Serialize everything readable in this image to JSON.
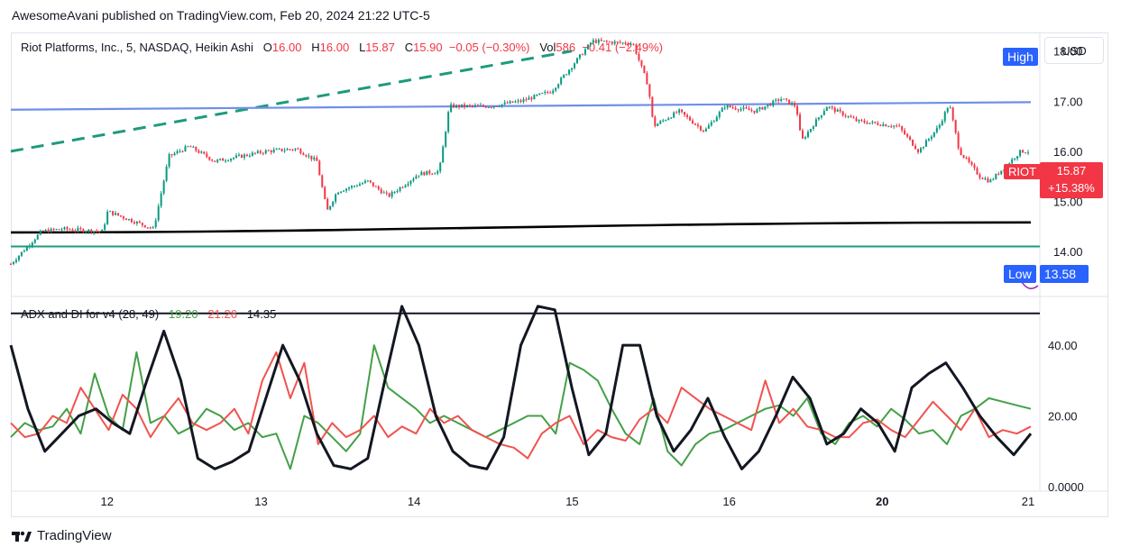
{
  "header": {
    "publisher": "AwesomeAvani published on TradingView.com, Feb 20, 2024 21:22 UTC-5"
  },
  "legend": {
    "symbol": "Riot Platforms, Inc., 5, NASDAQ, Heikin Ashi",
    "o_label": "O",
    "o_value": "16.00",
    "h_label": "H",
    "h_value": "16.00",
    "l_label": "L",
    "l_value": "15.87",
    "c_label": "C",
    "c_value": "15.90",
    "change": "−0.05 (−0.30%)",
    "vol_label": "Vol",
    "vol_value": "586",
    "vol_change": "−0.41 (−2.49%)"
  },
  "indicator_legend": {
    "name": "ADX and DI for v4 (28, 49)",
    "di_plus": "19.20",
    "di_minus": "21.26",
    "adx": "14.35"
  },
  "currency": "USD",
  "badges": {
    "high": "High",
    "low": "Low",
    "low_value": "13.58",
    "ticker": "RIOT",
    "last_price": "15.87",
    "last_change": "+15.38%"
  },
  "footer": {
    "brand": "TradingView"
  },
  "colors": {
    "up": "#089981",
    "down": "#f23645",
    "ma": "#6f8fe8",
    "trend": "#1e9a7d",
    "support": "#1e9a7d",
    "black": "#000000",
    "di_plus": "#43a047",
    "di_minus": "#f05350",
    "adx": "#131722",
    "badge_blue": "#2962ff"
  },
  "chart_data": [
    {
      "type": "line",
      "subtype": "heikin-ashi candles",
      "x_ticks": [
        "12",
        "13",
        "14",
        "15",
        "16",
        "20",
        "21"
      ],
      "y_ticks": [
        "18.00",
        "17.00",
        "16.00",
        "15.00",
        "14.00"
      ],
      "ylim": [
        13.3,
        18.3
      ],
      "price_path": [
        [
          0,
          13.75
        ],
        [
          0.03,
          14.4
        ],
        [
          0.05,
          14.45
        ],
        [
          0.09,
          14.4
        ],
        [
          0.095,
          14.8
        ],
        [
          0.14,
          14.45
        ],
        [
          0.155,
          15.9
        ],
        [
          0.175,
          16.1
        ],
        [
          0.2,
          15.8
        ],
        [
          0.25,
          16.0
        ],
        [
          0.28,
          16.05
        ],
        [
          0.3,
          15.8
        ],
        [
          0.31,
          14.8
        ],
        [
          0.32,
          15.2
        ],
        [
          0.35,
          15.4
        ],
        [
          0.37,
          15.1
        ],
        [
          0.4,
          15.55
        ],
        [
          0.42,
          15.6
        ],
        [
          0.43,
          16.9
        ],
        [
          0.47,
          16.9
        ],
        [
          0.5,
          17.0
        ],
        [
          0.53,
          17.2
        ],
        [
          0.55,
          17.7
        ],
        [
          0.57,
          18.2
        ],
        [
          0.61,
          18.15
        ],
        [
          0.625,
          17.3
        ],
        [
          0.63,
          16.5
        ],
        [
          0.655,
          16.8
        ],
        [
          0.68,
          16.4
        ],
        [
          0.7,
          16.9
        ],
        [
          0.73,
          16.8
        ],
        [
          0.755,
          17.05
        ],
        [
          0.77,
          16.9
        ],
        [
          0.775,
          16.2
        ],
        [
          0.8,
          16.9
        ],
        [
          0.83,
          16.6
        ],
        [
          0.87,
          16.5
        ],
        [
          0.89,
          16.0
        ],
        [
          0.91,
          16.5
        ],
        [
          0.92,
          16.95
        ],
        [
          0.93,
          16.0
        ],
        [
          0.95,
          15.5
        ],
        [
          0.96,
          15.4
        ],
        [
          0.975,
          15.7
        ],
        [
          0.99,
          16.0
        ]
      ],
      "blue_ma": {
        "start": 16.83,
        "end": 16.98
      },
      "black_ma": {
        "start": 14.38,
        "end": 14.58
      },
      "support_line": 14.1,
      "trend_line": {
        "start": 16.0,
        "end": 18.0
      }
    },
    {
      "type": "line",
      "title": "ADX and DI for v4 (28, 49)",
      "y_ticks": [
        "40.00",
        "20.00",
        "0.0000"
      ],
      "ylim": [
        0,
        52
      ],
      "threshold": 49,
      "series": [
        {
          "name": "DI+",
          "values": [
            14,
            18,
            16,
            17,
            22,
            15,
            32,
            20,
            16,
            38,
            18,
            20,
            15,
            17,
            22,
            20,
            16,
            18,
            14,
            15,
            5,
            20,
            18,
            14,
            10,
            15,
            40,
            28,
            25,
            22,
            18,
            20,
            18,
            16,
            14,
            16,
            18,
            20,
            20,
            15,
            35,
            33,
            30,
            22,
            15,
            12,
            25,
            10,
            6,
            12,
            15,
            16,
            18,
            20,
            22,
            23,
            20,
            25,
            15,
            12,
            18,
            20,
            17,
            22,
            19,
            15,
            16,
            12,
            20,
            22,
            25,
            24,
            23,
            22
          ]
        },
        {
          "name": "DI−",
          "values": [
            18,
            14,
            15,
            20,
            18,
            28,
            22,
            16,
            26,
            22,
            14,
            20,
            25,
            18,
            16,
            18,
            22,
            15,
            30,
            38,
            25,
            35,
            12,
            18,
            14,
            16,
            20,
            14,
            17,
            15,
            22,
            18,
            20,
            16,
            14,
            12,
            11,
            8,
            15,
            18,
            20,
            12,
            16,
            14,
            13,
            19,
            22,
            18,
            28,
            25,
            22,
            20,
            18,
            16,
            30,
            18,
            22,
            17,
            16,
            14,
            14,
            18,
            19,
            16,
            14,
            19,
            24,
            20,
            16,
            22,
            14,
            16,
            15,
            17
          ]
        },
        {
          "name": "ADX",
          "values": [
            40,
            22,
            10,
            15,
            20,
            22,
            18,
            15,
            30,
            44,
            30,
            8,
            5,
            7,
            10,
            25,
            40,
            30,
            15,
            6,
            5,
            8,
            30,
            51,
            40,
            20,
            10,
            6,
            5,
            14,
            40,
            51,
            50,
            28,
            9,
            15,
            40,
            40,
            20,
            10,
            16,
            25,
            14,
            5,
            10,
            20,
            31,
            25,
            12,
            15,
            22,
            18,
            10,
            28,
            32,
            35,
            28,
            20,
            14,
            9,
            15
          ]
        }
      ]
    }
  ]
}
